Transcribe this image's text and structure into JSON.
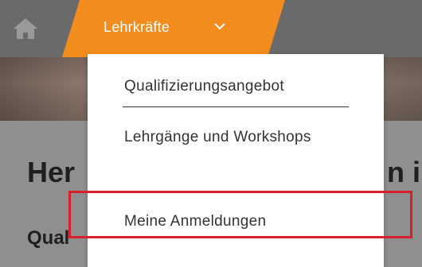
{
  "navbar": {
    "home_icon": "home-icon",
    "active_tab_label": "Lehrkräfte",
    "active_tab_color": "#f28c1c",
    "chevron_icon": "chevron-down-icon"
  },
  "page": {
    "heading_left": "Her",
    "heading_right": "n i",
    "subheading_left": "Qual"
  },
  "dropdown": {
    "items": [
      {
        "label": "Qualifizierungsangebot"
      },
      {
        "label": "Lehrgänge und Workshops"
      },
      {
        "label": "Meine Anmeldungen"
      }
    ]
  },
  "annotation": {
    "highlight_color": "#d8202c",
    "highlighted_item": "Meine Anmeldungen"
  }
}
